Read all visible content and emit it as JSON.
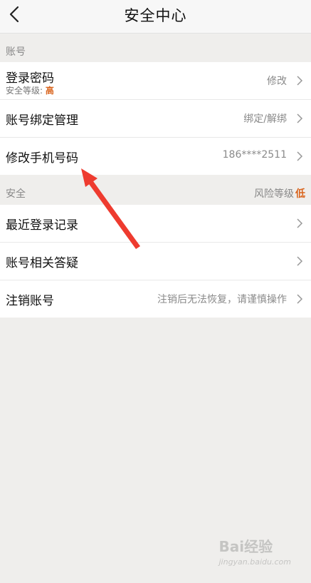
{
  "header": {
    "title": "安全中心"
  },
  "section_account": {
    "label": "账号"
  },
  "account_items": [
    {
      "title": "登录密码",
      "sub_prefix": "安全等级: ",
      "sub_level": "高",
      "value": "修改"
    },
    {
      "title": "账号绑定管理",
      "value": "绑定/解绑"
    },
    {
      "title": "修改手机号码",
      "value": "186****2511"
    }
  ],
  "section_security": {
    "label": "安全",
    "risk_prefix": "风险等级",
    "risk_level": "低"
  },
  "security_items": [
    {
      "title": "最近登录记录",
      "value": ""
    },
    {
      "title": "账号相关答疑",
      "value": ""
    },
    {
      "title": "注销账号",
      "value": "注销后无法恢复，请谨慎操作"
    }
  ],
  "watermark": {
    "brand": "Bai",
    "brand2": "经验",
    "sub": "jingyan.baidu.com"
  },
  "colors": {
    "accent": "#d9641d",
    "annotation_arrow": "#ee3b2f"
  }
}
